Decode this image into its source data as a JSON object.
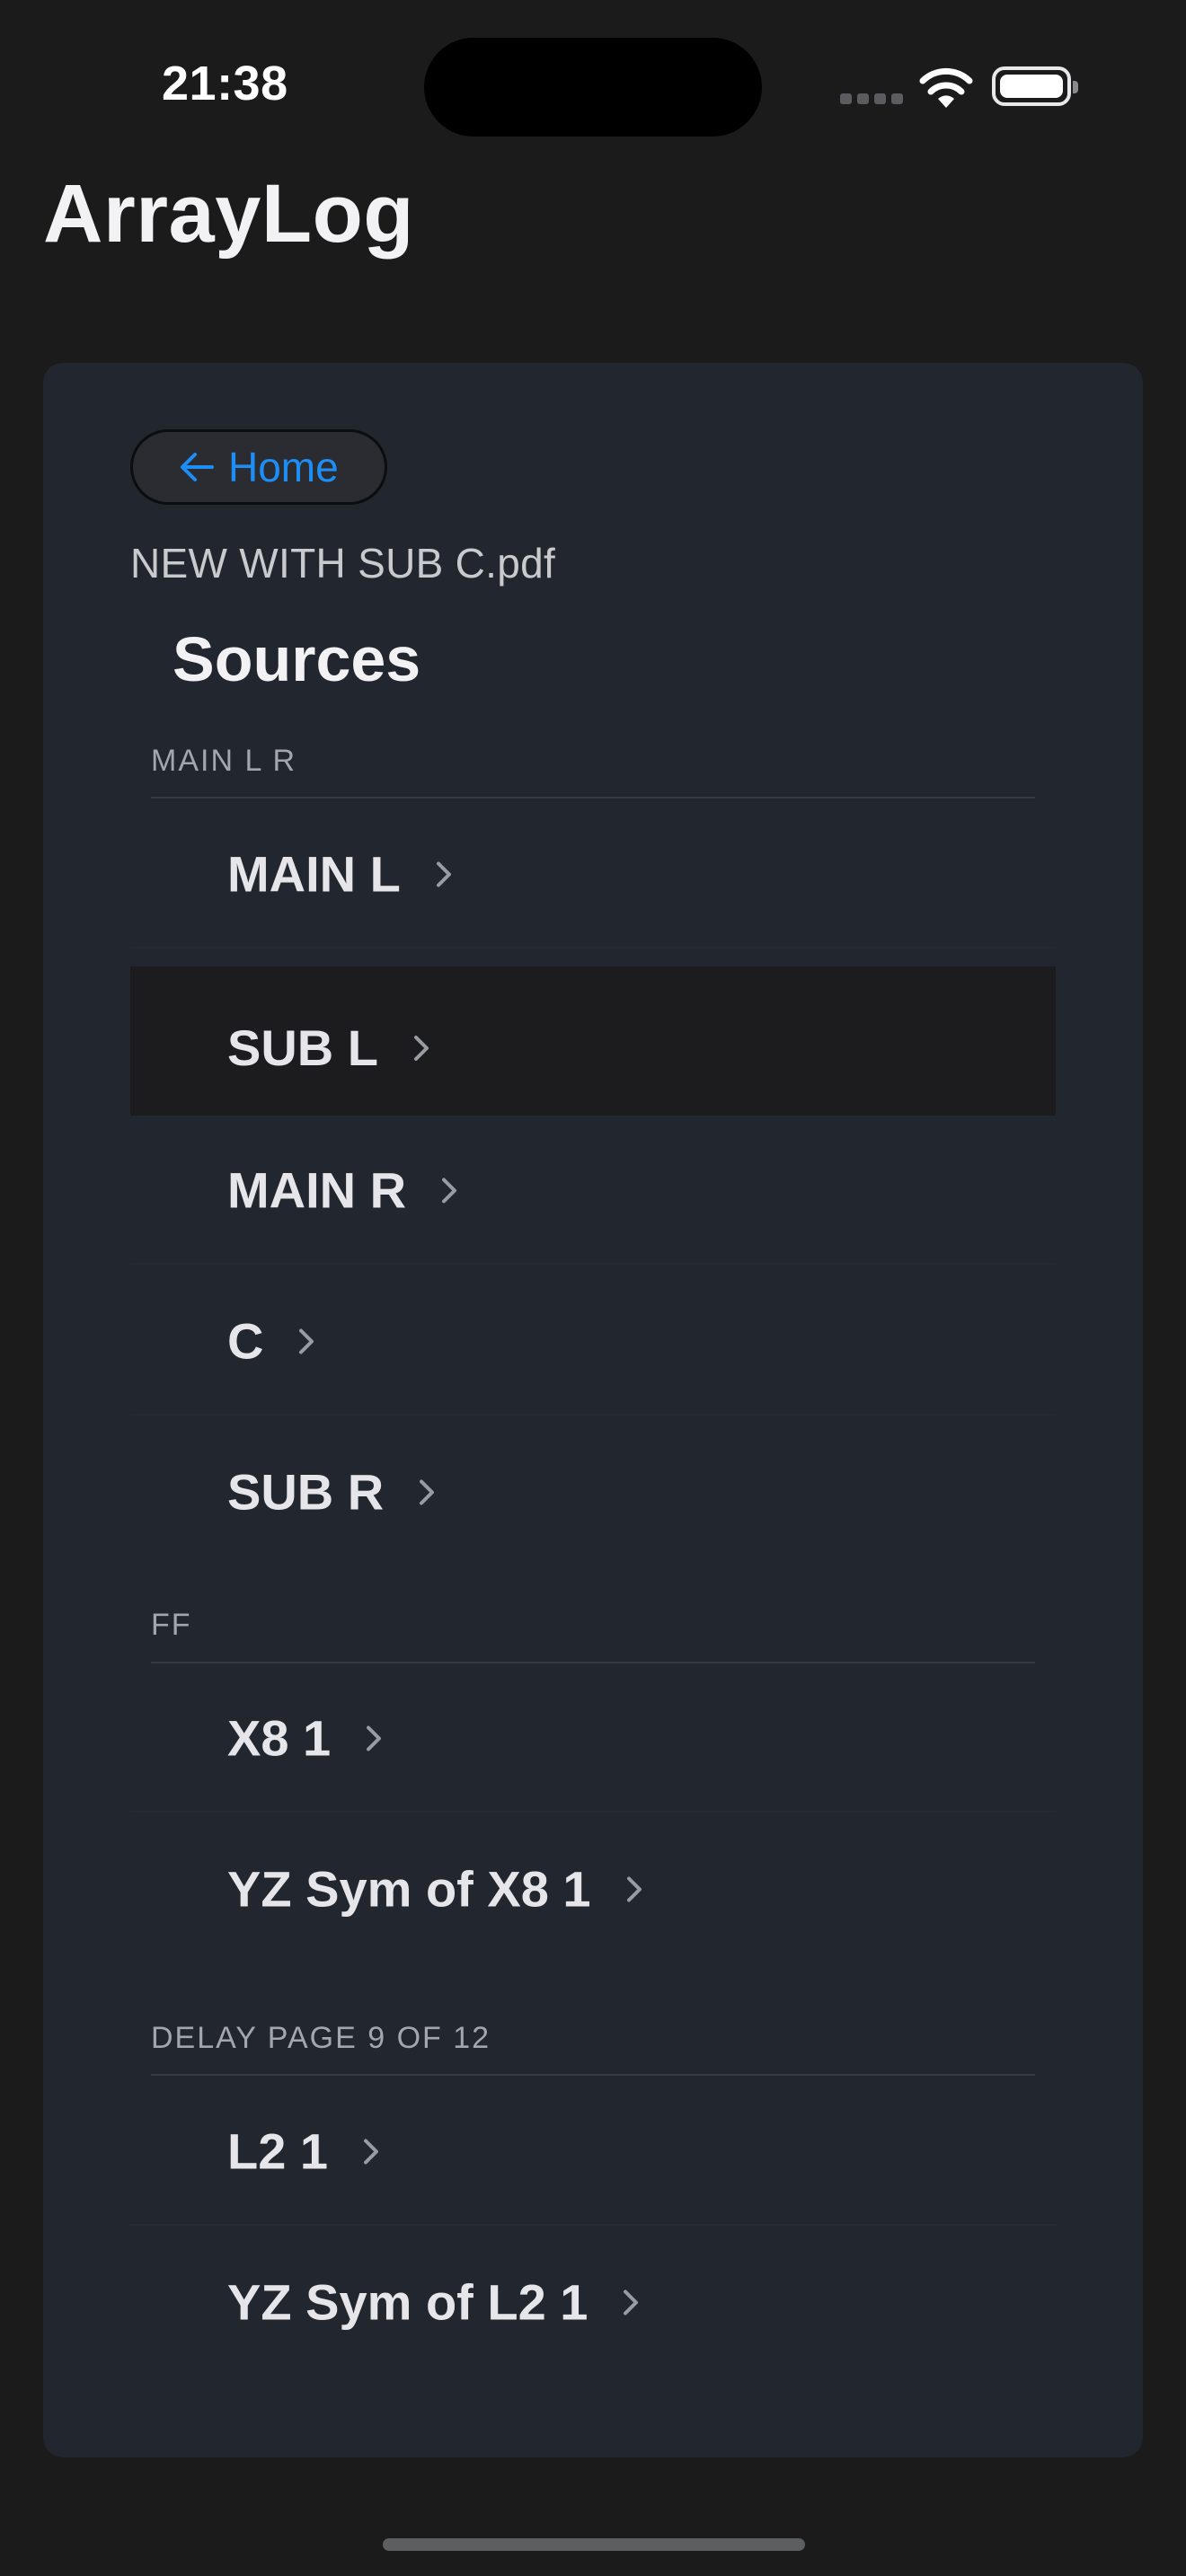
{
  "status_bar": {
    "time": "21:38"
  },
  "app": {
    "title": "ArrayLog"
  },
  "nav": {
    "home_label": "Home"
  },
  "document": {
    "file_name": "NEW WITH SUB C.pdf"
  },
  "sources": {
    "heading": "Sources",
    "sections": [
      {
        "title": "MAIN L R",
        "items": [
          "MAIN L",
          "SUB L",
          "MAIN R",
          "C",
          "SUB R"
        ]
      },
      {
        "title": "FF",
        "items": [
          "X8 1",
          "YZ Sym of X8 1"
        ]
      },
      {
        "title": "DELAY PAGE 9 OF 12",
        "items": [
          "L2 1",
          "YZ Sym of L2 1"
        ]
      }
    ],
    "selected_item": "SUB L"
  },
  "colors": {
    "background": "#1b1b1c",
    "card": "#22262f",
    "accent": "#1d8ef5",
    "selected_row": "#1c1c1e"
  }
}
